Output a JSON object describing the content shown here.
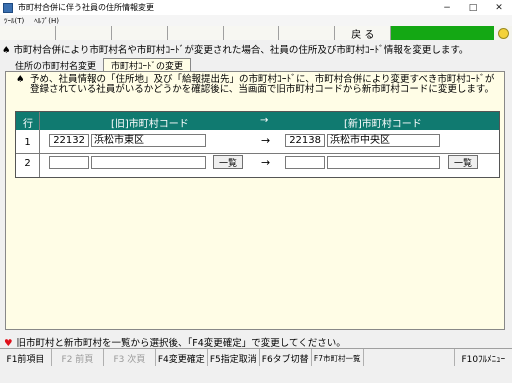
{
  "window": {
    "title": "市町村合併に伴う社員の住所情報変更",
    "minimize": "−",
    "maximize": "□",
    "close": "✕"
  },
  "menu": [
    {
      "label": "ﾂｰﾙ(T)"
    },
    {
      "label": "ﾍﾙﾌﾟ(H)"
    }
  ],
  "toolbar": {
    "back_label": "戻 る",
    "status_color": "#14a814"
  },
  "info_line": "♠ 市町村合併により市町村名や市町村ｺｰﾄﾞが変更された場合、社員の住所及び市町村ｺｰﾄﾞ情報を変更します。",
  "tabs": [
    {
      "label": "住所の市町村名変更",
      "active": false
    },
    {
      "label": "市町村ｺｰﾄﾞの変更",
      "active": true
    }
  ],
  "instruction": {
    "bullet": "♠",
    "text": "予め、社員情報の「住所地」及び「給報提出先」の市町村ｺｰﾄﾞに、市町村合併により変更すべき市町村ｺｰﾄﾞが登録されている社員がいるかどうかを確認後に、当画面で旧市町村コードから新市町村コードに変更します。"
  },
  "grid": {
    "headers": {
      "row": "行",
      "old": "[旧]市町村コード",
      "arrow": "→",
      "new": "[新]市町村コード"
    },
    "rows": [
      {
        "no": "1",
        "old_code": "22132",
        "old_name": "浜松市東区",
        "arrow": "→",
        "new_code": "22138",
        "new_name": "浜松市中央区",
        "lookup": ""
      },
      {
        "no": "2",
        "old_code": "",
        "old_name": "",
        "arrow": "→",
        "new_code": "",
        "new_name": "",
        "lookup": "一覧"
      }
    ]
  },
  "status_message": "旧市町村と新市町村を一覧から選択後、「F4変更確定」で変更してください。",
  "fkeys": [
    {
      "label": "F1前項目"
    },
    {
      "label": "F2 前頁"
    },
    {
      "label": "F3 次頁"
    },
    {
      "label": "F4変更確定"
    },
    {
      "label": "F5指定取消"
    },
    {
      "label": "F6タブ切替"
    },
    {
      "label": "F7市町村一覧"
    },
    {
      "label": ""
    },
    {
      "label": "F10ﾌﾙﾒﾆｭｰ"
    }
  ]
}
